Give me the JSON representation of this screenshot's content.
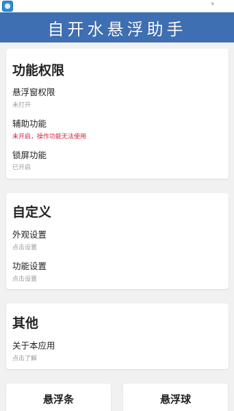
{
  "status_bar": {
    "app_icon": "app-icon",
    "signal_text": "ᵇ"
  },
  "app_bar": {
    "title": "自开水悬浮助手"
  },
  "sections": [
    {
      "title": "功能权限",
      "items": [
        {
          "label": "悬浮窗权限",
          "sub": "未打开"
        },
        {
          "label": "辅助功能",
          "sub": "未开启，操作功能无法使用"
        },
        {
          "label": "锁屏功能",
          "sub": "已开启"
        }
      ]
    },
    {
      "title": "自定义",
      "items": [
        {
          "label": "外观设置",
          "sub": "点击设置"
        },
        {
          "label": "功能设置",
          "sub": "点击设置"
        }
      ]
    },
    {
      "title": "其他",
      "items": [
        {
          "label": "关于本应用",
          "sub": "点击了解"
        }
      ]
    }
  ],
  "bottom_buttons": {
    "left": "悬浮条",
    "right": "悬浮球"
  },
  "colors": {
    "app_bar": "#3f6fb3",
    "warning_text": "#c8253b",
    "background": "#f1f1f1"
  }
}
